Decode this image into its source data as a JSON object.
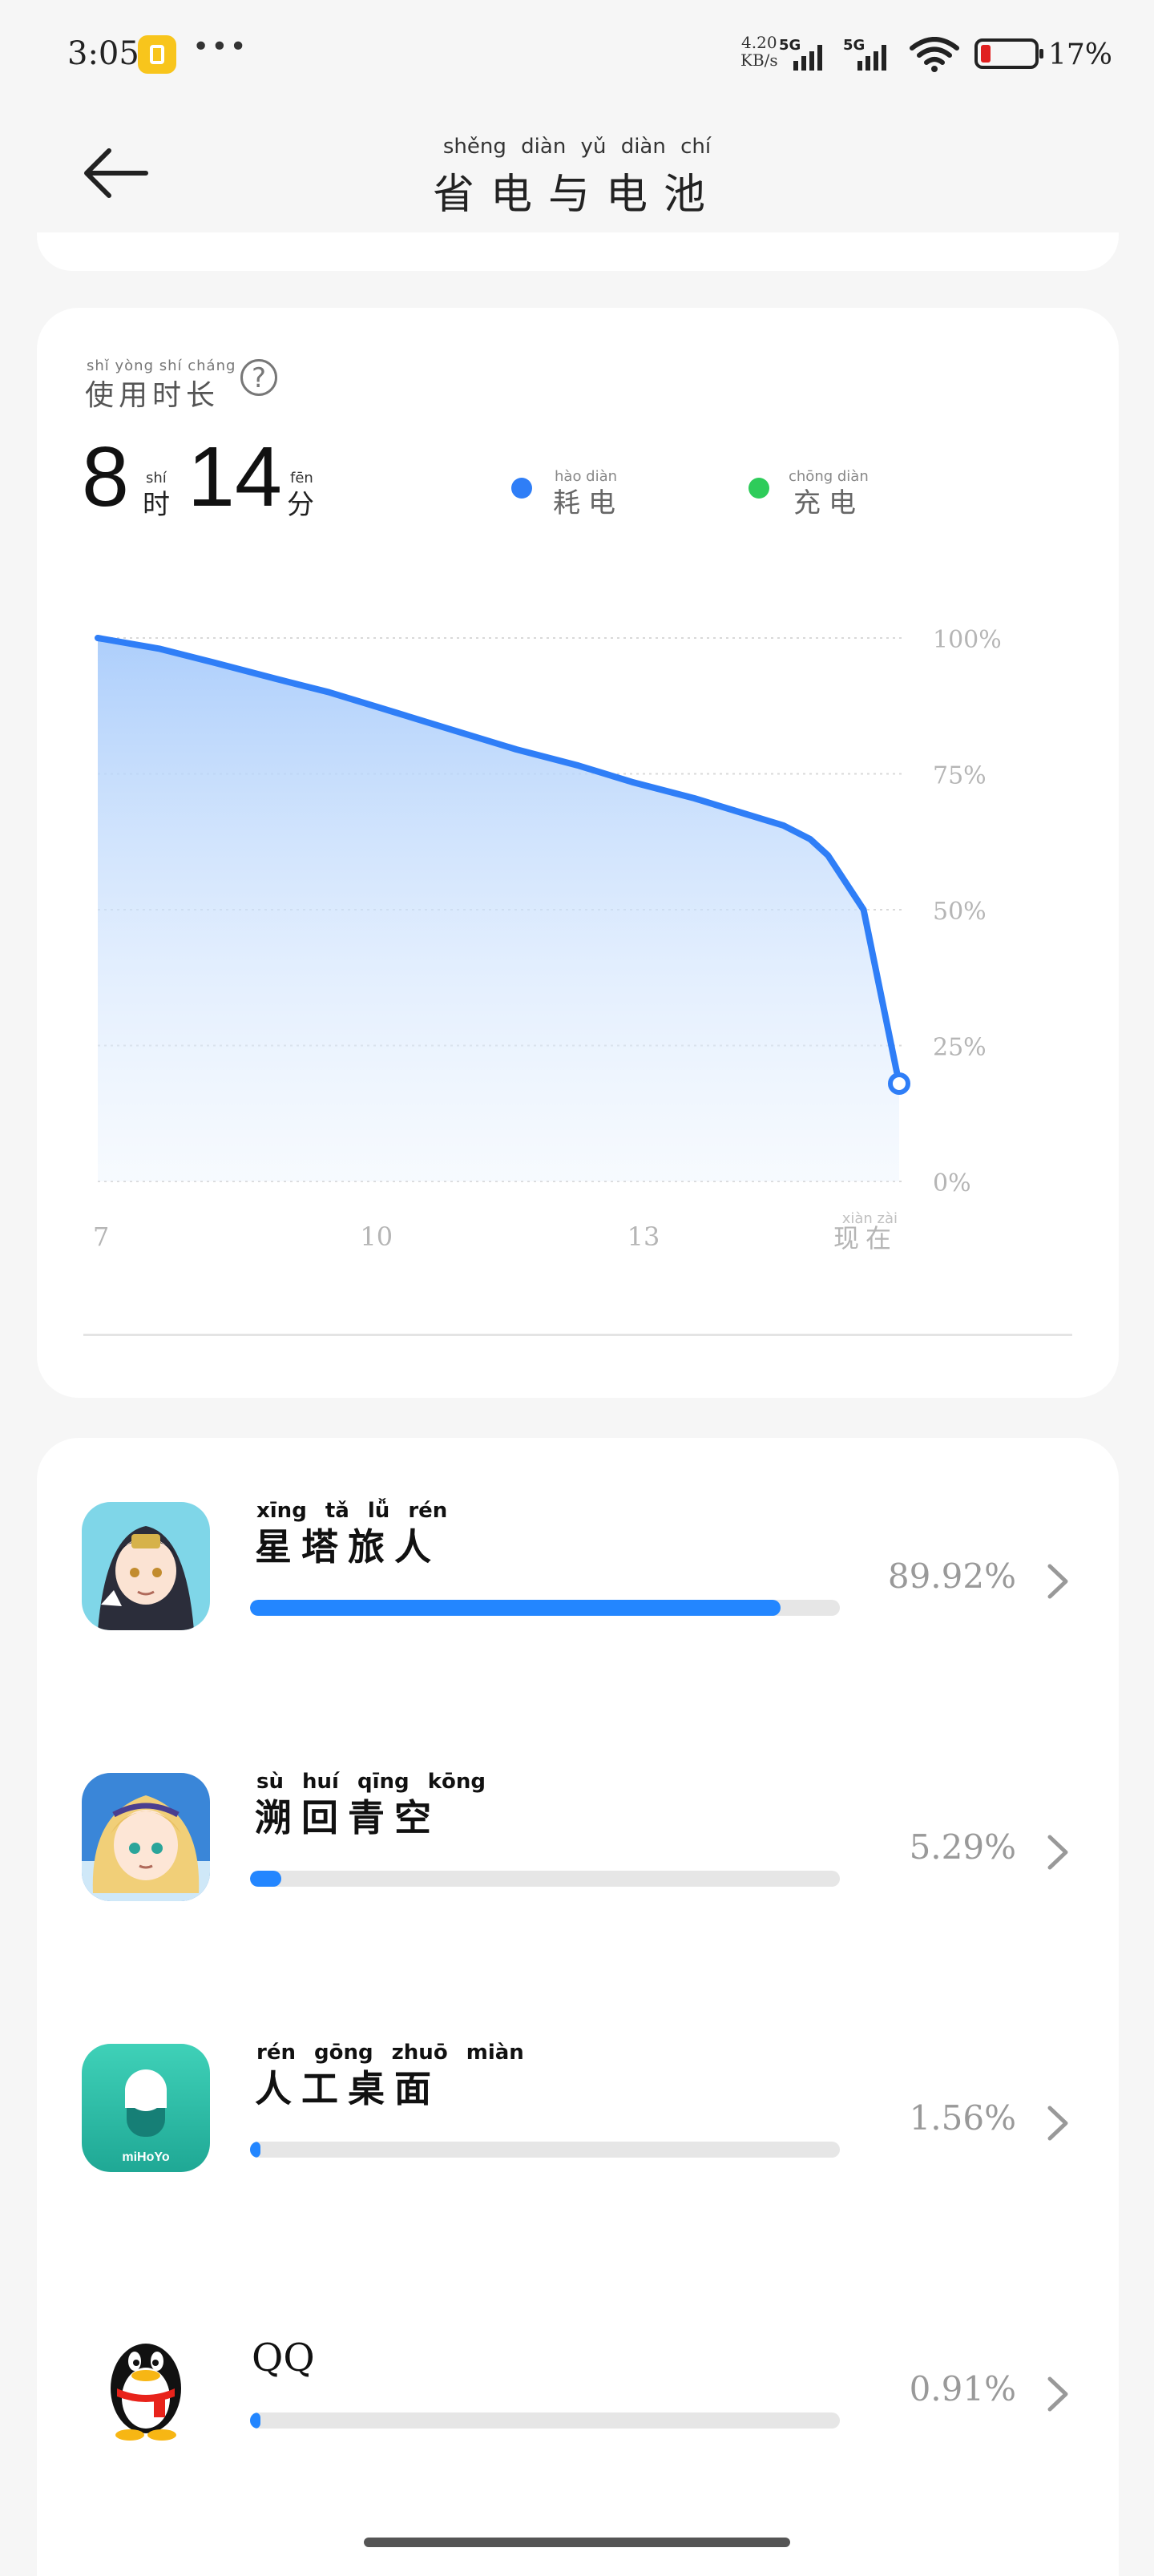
{
  "status_bar": {
    "time": "3:05",
    "speed_value": "4.20",
    "speed_unit": "KB/s",
    "signal1_label": "5G",
    "signal2_label": "5G",
    "battery_percent": "17%"
  },
  "header": {
    "title_pinyin": "shěng diàn  yǔ  diàn  chí",
    "title": "省电与电池"
  },
  "usage": {
    "label_pinyin": "shǐ yòng shí cháng",
    "label": "使用时长",
    "hours": "8",
    "hours_unit_pinyin": "shí",
    "hours_unit": "时",
    "minutes": "14",
    "minutes_unit_pinyin": "fēn",
    "minutes_unit": "分",
    "legend": [
      {
        "pinyin": "hào diàn",
        "label": "耗电",
        "color": "#2f7ef7"
      },
      {
        "pinyin": "chōng diàn",
        "label": "充电",
        "color": "#2ecc5a"
      }
    ]
  },
  "chart_data": {
    "type": "area",
    "y_tick_labels": [
      "100%",
      "75%",
      "50%",
      "25%",
      "0%"
    ],
    "x_tick_labels": [
      "7",
      "10",
      "13"
    ],
    "x_now_pinyin": "xiàn zài",
    "x_now_label": "现在",
    "ylim": [
      0,
      100
    ],
    "xlim": [
      7,
      16
    ],
    "x": [
      7,
      7.7,
      8.3,
      9,
      9.6,
      10.3,
      11,
      11.7,
      12.4,
      13,
      13.7,
      14.2,
      14.7,
      15.0,
      15.2,
      15.6,
      16
    ],
    "values": [
      100,
      98,
      95.5,
      92.5,
      90,
      86.5,
      83,
      79.5,
      76.5,
      73.5,
      70.5,
      68,
      65.5,
      63,
      60,
      50,
      18
    ],
    "grid": true,
    "series_color": "#2f7ef7"
  },
  "apps": [
    {
      "name_pinyin": "xīng  tǎ  lǚ  rén",
      "name": "星塔旅人",
      "percent_label": "89.92%",
      "percent": 89.92
    },
    {
      "name_pinyin": "sù  huí  qīng kōng",
      "name": "溯回青空",
      "percent_label": "5.29%",
      "percent": 5.29
    },
    {
      "name_pinyin": "rén gōng zhuō miàn",
      "name": "人工桌面",
      "percent_label": "1.56%",
      "percent": 1.56
    },
    {
      "name_pinyin": "",
      "name": "QQ",
      "percent_label": "0.91%",
      "percent": 0.91
    }
  ],
  "app_icon_texts": {
    "mihoyo": "miHoYo"
  }
}
